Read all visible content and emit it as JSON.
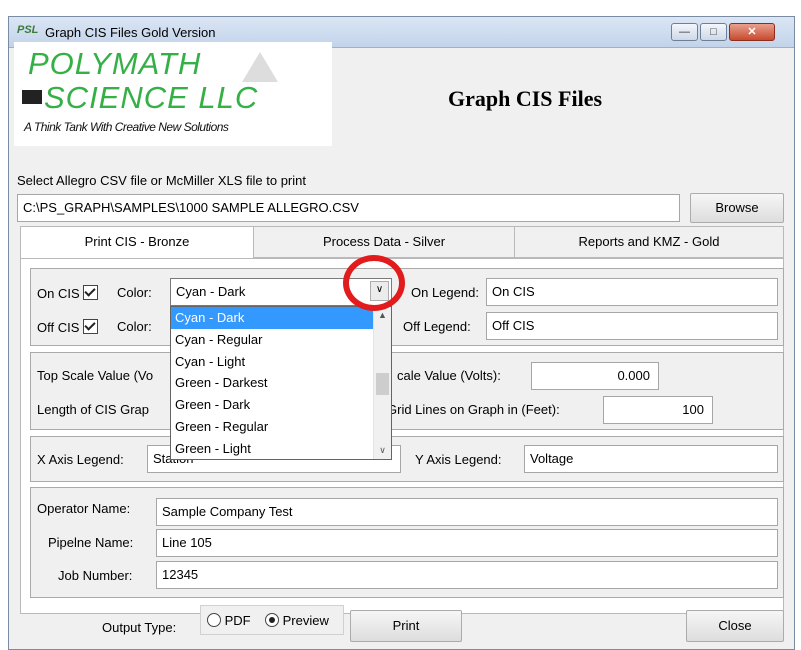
{
  "window": {
    "title": "Graph CIS Files Gold Version",
    "app_icon_text": "PSL",
    "minimize_icon": "minimize-icon",
    "maximize_icon": "maximize-icon",
    "close_icon": "close-icon"
  },
  "logo": {
    "line1": "POLYMATH",
    "line2": "SCIENCE LLC",
    "tagline": "A Think Tank With Creative New Solutions"
  },
  "heading": "Graph CIS Files",
  "file": {
    "label": "Select Allegro CSV file or McMiller XLS file to print",
    "path": "C:\\PS_GRAPH\\SAMPLES\\1000 SAMPLE ALLEGRO.CSV",
    "browse_label": "Browse"
  },
  "tabs": [
    {
      "label": "Print CIS - Bronze",
      "active": true
    },
    {
      "label": "Process Data - Silver",
      "active": false
    },
    {
      "label": "Reports and KMZ - Gold",
      "active": false
    }
  ],
  "cis": {
    "on_label": "On CIS",
    "off_label": "Off CIS",
    "color_label": "Color:",
    "on_color_value": "Cyan - Dark",
    "on_legend_label": "On Legend:",
    "on_legend_value": "On CIS",
    "off_legend_label": "Off Legend:",
    "off_legend_value": "Off CIS",
    "on_checked": true,
    "off_checked": true
  },
  "dropdown_options": [
    "Cyan - Dark",
    "Cyan - Regular",
    "Cyan - Light",
    "Green - Darkest",
    "Green - Dark",
    "Green - Regular",
    "Green - Light"
  ],
  "scale": {
    "top_label": "Top Scale Value (Vo",
    "bottom_label": "cale Value (Volts):",
    "bottom_value": "0.000",
    "length_label": "Length of CIS Grap",
    "grid_label": "Grid Lines on Graph in (Feet):",
    "grid_value": "100"
  },
  "axis": {
    "x_label": "X Axis Legend:",
    "x_value": "Station",
    "y_label": "Y Axis Legend:",
    "y_value": "Voltage"
  },
  "info": {
    "operator_label": "Operator Name:",
    "operator_value": "Sample Company Test",
    "pipeline_label": "Pipelne Name:",
    "pipeline_value": "Line 105",
    "job_label": "Job Number:",
    "job_value": "12345"
  },
  "footer": {
    "output_label": "Output Type:",
    "pdf_label": "PDF",
    "preview_label": "Preview",
    "selected": "Preview",
    "print_label": "Print",
    "close_label": "Close"
  }
}
